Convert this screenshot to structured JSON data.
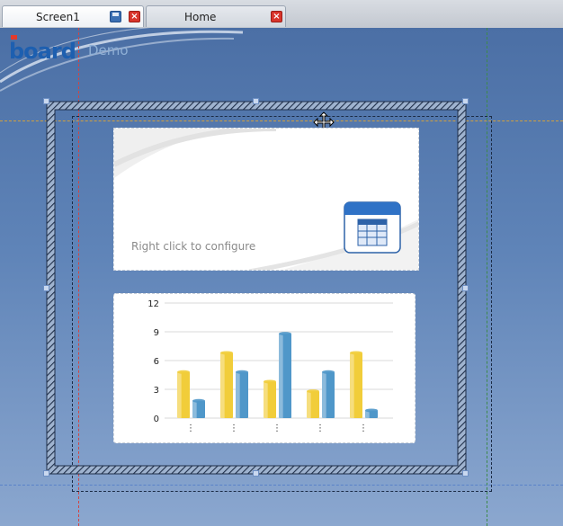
{
  "tabs": [
    {
      "label": "Screen1",
      "active": true,
      "icons": [
        "save-icon",
        "close-icon"
      ]
    },
    {
      "label": "Home",
      "active": false,
      "icons": [
        "close-icon"
      ]
    }
  ],
  "logo": {
    "text": "board",
    "suffix": "Demo"
  },
  "panel_table": {
    "prompt": "Right click to configure",
    "icon": "table-icon"
  },
  "chart_data": {
    "type": "bar",
    "categories": [
      "⋮",
      "⋮",
      "⋮",
      "⋮",
      "⋮"
    ],
    "series": [
      {
        "values": [
          4.8,
          6.8,
          3.8,
          2.8,
          6.8
        ],
        "color": "#f1cd3a"
      },
      {
        "values": [
          1.8,
          4.8,
          8.8,
          4.8,
          0.8
        ],
        "color": "#4f97c9"
      }
    ],
    "ylim": [
      0,
      12
    ],
    "yticks": [
      0,
      3,
      6,
      9,
      12
    ],
    "grid": true
  },
  "colors": {
    "yellow_series": "#f1cd3a",
    "blue_series": "#4f97c9",
    "background": "#5a7fb0"
  }
}
